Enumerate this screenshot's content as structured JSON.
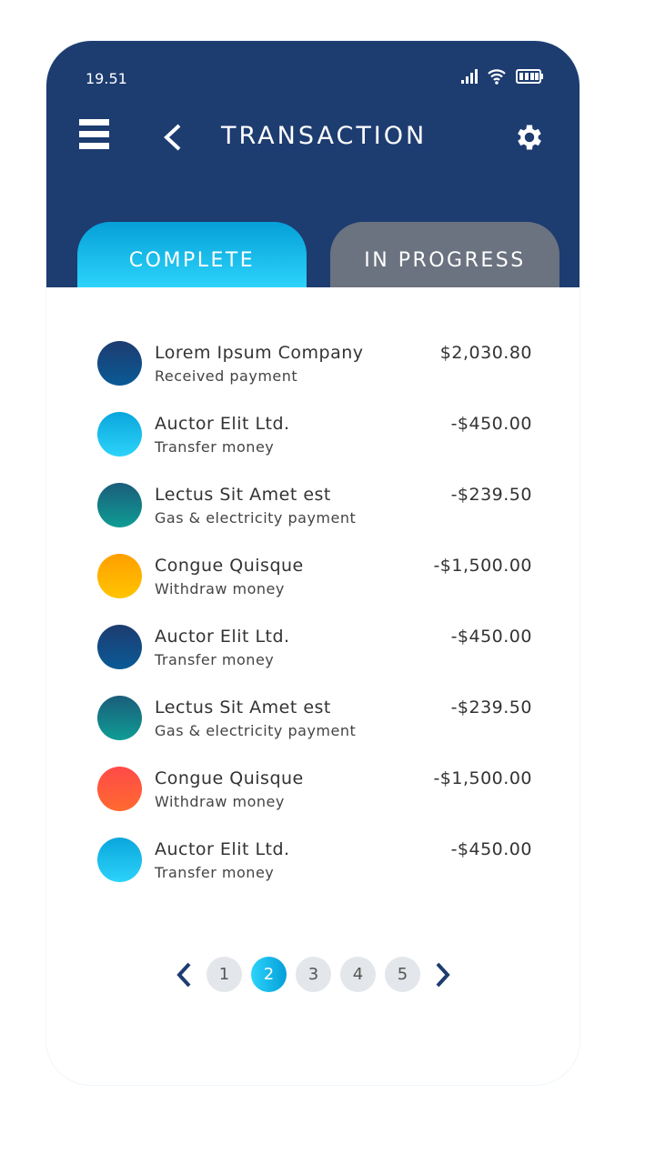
{
  "status_bar": {
    "time": "19.51",
    "icons": [
      "signal-icon",
      "wifi-icon",
      "battery-icon"
    ]
  },
  "header": {
    "title": "TRANSACTION",
    "menu_icon": "hamburger-icon",
    "back_icon": "chevron-left-icon",
    "settings_icon": "gear-icon"
  },
  "tabs": [
    {
      "label": "COMPLETE",
      "active": true
    },
    {
      "label": "IN PROGRESS",
      "active": false
    }
  ],
  "transactions": [
    {
      "name": "Lorem Ipsum Company",
      "desc": "Received payment",
      "amount": "$2,030.80",
      "color": [
        "#1d3c70",
        "#0a5a96"
      ]
    },
    {
      "name": "Auctor Elit Ltd.",
      "desc": "Transfer money",
      "amount": "-$450.00",
      "color": [
        "#0aa6dc",
        "#2cd3fa"
      ]
    },
    {
      "name": "Lectus Sit Amet est",
      "desc": "Gas & electricity payment",
      "amount": "-$239.50",
      "color": [
        "#1a5d7a",
        "#0f9c94"
      ]
    },
    {
      "name": "Congue Quisque",
      "desc": "Withdraw money",
      "amount": "-$1,500.00",
      "color": [
        "#ff9f00",
        "#ffc400"
      ]
    },
    {
      "name": "Auctor Elit Ltd.",
      "desc": "Transfer money",
      "amount": "-$450.00",
      "color": [
        "#1d3c70",
        "#0a5a96"
      ]
    },
    {
      "name": "Lectus Sit Amet est",
      "desc": "Gas & electricity payment",
      "amount": "-$239.50",
      "color": [
        "#1a5d7a",
        "#0f9c94"
      ]
    },
    {
      "name": "Congue Quisque",
      "desc": "Withdraw money",
      "amount": "-$1,500.00",
      "color": [
        "#ff4a48",
        "#ff6a30"
      ]
    },
    {
      "name": "Auctor Elit Ltd.",
      "desc": "Transfer money",
      "amount": "-$450.00",
      "color": [
        "#0aa6dc",
        "#2cd3fa"
      ]
    }
  ],
  "pagination": {
    "pages": [
      "1",
      "2",
      "3",
      "4",
      "5"
    ],
    "current": "2"
  },
  "colors": {
    "header": "#1d3c70",
    "accent": "#0aa6dc",
    "inactive_tab": "#6b7280"
  }
}
